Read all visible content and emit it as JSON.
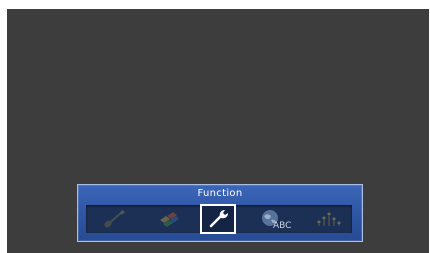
{
  "menu": {
    "title": "Function",
    "items": [
      {
        "icon": "guitar-icon",
        "selected": false
      },
      {
        "icon": "puzzle-icon",
        "selected": false
      },
      {
        "icon": "wrench-icon",
        "selected": true
      },
      {
        "icon": "globe-abc-icon",
        "label": "ABC",
        "selected": false
      },
      {
        "icon": "level-meter-icon",
        "selected": false
      }
    ]
  },
  "colors": {
    "background": "#3d3d3d",
    "panel": "#2e55a4",
    "panel_border": "#a9bde6",
    "strip": "#1c2f55",
    "selection": "#ffffff"
  }
}
